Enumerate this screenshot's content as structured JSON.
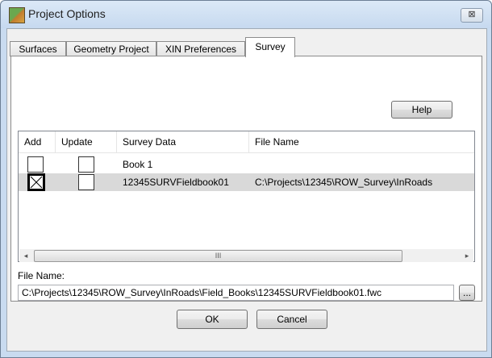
{
  "window": {
    "title": "Project Options",
    "close_glyph": "⊠"
  },
  "tabs": [
    {
      "label": "Surfaces",
      "active": false
    },
    {
      "label": "Geometry Project",
      "active": false
    },
    {
      "label": "XIN Preferences",
      "active": false
    },
    {
      "label": "Survey",
      "active": true
    }
  ],
  "survey": {
    "help_label": "Help",
    "columns": {
      "add": "Add",
      "update": "Update",
      "survey_data": "Survey Data",
      "file_name": "File Name"
    },
    "rows": [
      {
        "add_checked": false,
        "update_checked": false,
        "survey_data": "Book 1",
        "file_name": "",
        "selected": false
      },
      {
        "add_checked": true,
        "update_checked": false,
        "survey_data": "12345SURVFieldbook01",
        "file_name": "C:\\Projects\\12345\\ROW_Survey\\InRoads",
        "selected": true
      }
    ],
    "scrollbar": {
      "left_arrow": "◂",
      "right_arrow": "▸",
      "thumb_grip": "III"
    },
    "file_name_label": "File Name:",
    "file_name_value": "C:\\Projects\\12345\\ROW_Survey\\InRoads\\Field_Books\\12345SURVFieldbook01.fwc",
    "browse_label": "..."
  },
  "footer": {
    "ok_label": "OK",
    "cancel_label": "Cancel"
  }
}
